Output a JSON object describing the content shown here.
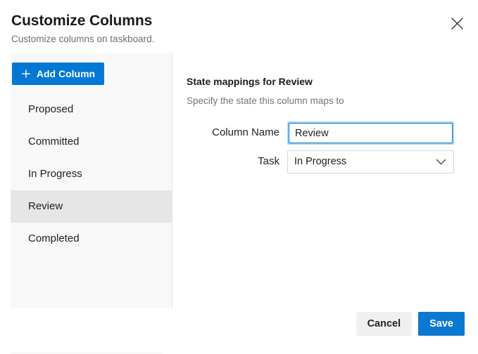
{
  "header": {
    "title": "Customize Columns",
    "subtitle": "Customize columns on taskboard.",
    "close_icon": "close-icon"
  },
  "columns_panel": {
    "add_button": {
      "label": "Add Column",
      "icon": "plus-icon",
      "background_color": "#0078d4"
    },
    "items": [
      {
        "label": "Proposed",
        "selected": false
      },
      {
        "label": "Committed",
        "selected": false
      },
      {
        "label": "In Progress",
        "selected": false
      },
      {
        "label": "Review",
        "selected": true
      },
      {
        "label": "Completed",
        "selected": false
      }
    ],
    "selected_background_color": "#e6e6e6",
    "panel_background_color": "#f8f8f8"
  },
  "mapping": {
    "title": "State mappings for Review",
    "subtitle": "Specify the state this column maps to",
    "fields": [
      {
        "label": "Column Name",
        "type": "text",
        "value": "Review",
        "placeholder": "",
        "focused": true,
        "focus_border_color": "#0b78d1",
        "focus_ring_color": "#a9d3f2"
      },
      {
        "label": "Task",
        "type": "select",
        "value": "In Progress",
        "icon": "chevron-down-icon",
        "options": [
          "In Progress"
        ]
      }
    ]
  },
  "footer": {
    "cancel_label": "Cancel",
    "save_label": "Save",
    "primary_color": "#0b78d1"
  }
}
